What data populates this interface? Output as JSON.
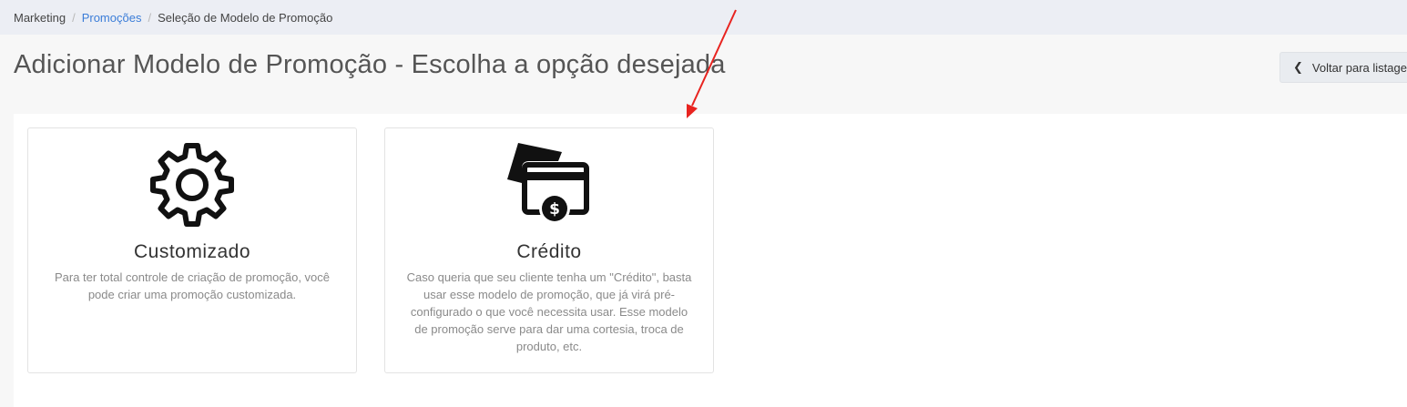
{
  "breadcrumb": {
    "items": [
      "Marketing",
      "Promoções",
      "Seleção de Modelo de Promoção"
    ],
    "separator": "/"
  },
  "page": {
    "title": "Adicionar Modelo de Promoção - Escolha a opção desejada",
    "back_button_label": "Voltar para listagem",
    "back_icon": "chevron-left-icon"
  },
  "cards": [
    {
      "icon": "gear-icon",
      "title": "Customizado",
      "description": "Para ter total controle de criação de promoção, você pode criar uma promoção customizada."
    },
    {
      "icon": "credit-card-dollar-icon",
      "title": "Crédito",
      "description": "Caso queria que seu cliente tenha um \"Crédito\", basta usar esse modelo de promoção, que já virá pré-configurado o que você necessita usar. Esse modelo de promoção serve para dar uma cortesia, troca de produto, etc."
    }
  ],
  "colors": {
    "link": "#3b7dd8",
    "annotation_arrow": "#e8231f",
    "breadcrumb_bg": "#eceef4"
  }
}
